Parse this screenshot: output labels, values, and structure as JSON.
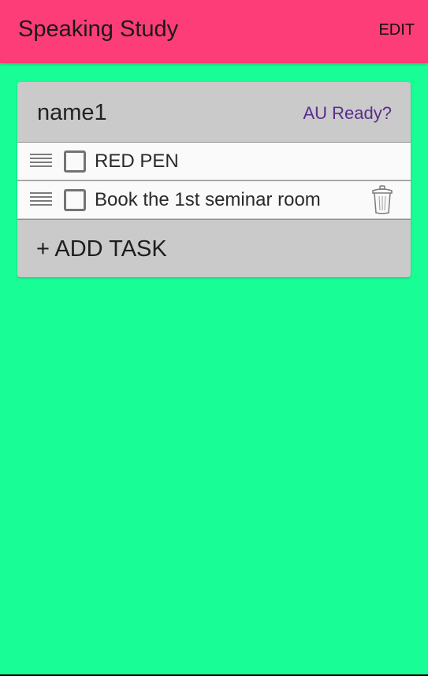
{
  "app_bar": {
    "title": "Speaking Study",
    "edit_label": "EDIT"
  },
  "card": {
    "name": "name1",
    "status": "AU Ready?",
    "tasks": [
      {
        "label": "RED PEN",
        "checked": false,
        "handle_icon": "drag-handle-icon"
      },
      {
        "label": "Book the 1st seminar room",
        "checked": false,
        "handle_icon": "drag-handle-icon",
        "action_icon": "trash-icon"
      }
    ],
    "add_task_label": "+ ADD TASK"
  },
  "colors": {
    "app_bar": "#fc3d77",
    "background": "#18fd96",
    "card": "#cacaca",
    "row": "#fafafa",
    "status_text": "#5a2d8c"
  }
}
